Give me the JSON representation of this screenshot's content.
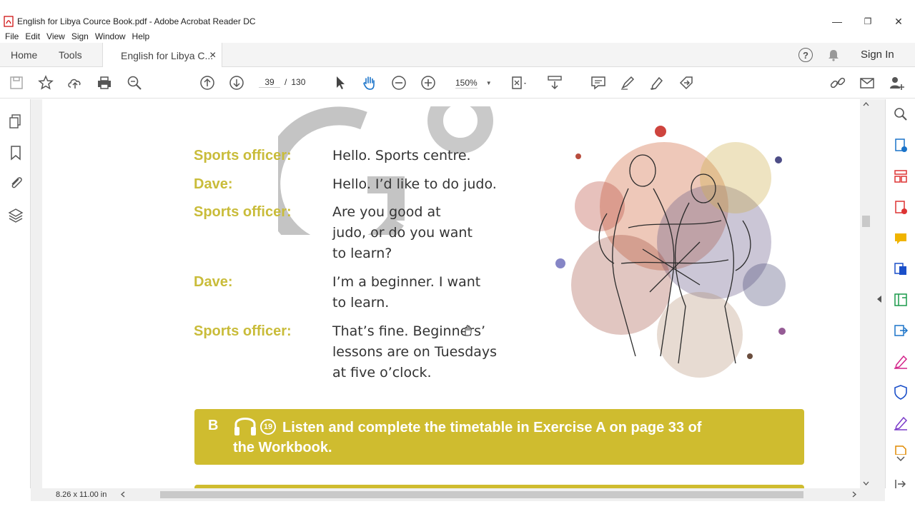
{
  "window": {
    "title": "English for Libya Cource Book.pdf - Adobe Acrobat Reader DC",
    "controls": {
      "minimize": "—",
      "restore": "❐",
      "close": "✕"
    }
  },
  "menu": [
    "File",
    "Edit",
    "View",
    "Sign",
    "Window",
    "Help"
  ],
  "tabs": {
    "home": "Home",
    "tools": "Tools",
    "doc": "English for Libya C...",
    "close": "×"
  },
  "header_right": {
    "help": "?",
    "sign_in": "Sign In"
  },
  "toolbar": {
    "page_current": "39",
    "page_sep": "/",
    "page_total": "130",
    "zoom": "150%"
  },
  "status": {
    "page_size": "8.26 x 11.00 in"
  },
  "document": {
    "dialogue": [
      {
        "speaker": "Sports officer:",
        "text": "Hello. Sports centre."
      },
      {
        "speaker": "Dave:",
        "text": "Hello. I’d like to do judo."
      },
      {
        "speaker": "Sports officer:",
        "lines": [
          "Are you good at",
          "judo, or do you want",
          "to learn?"
        ]
      },
      {
        "speaker": "Dave:",
        "lines": [
          "I’m a beginner. I want",
          "to learn."
        ]
      },
      {
        "speaker": "Sports officer:",
        "lines": [
          "That’s fine. Beginners’",
          "lessons are on Tuesdays",
          "at five o’clock."
        ]
      }
    ],
    "exercise": {
      "letter": "B",
      "track": "19",
      "lines": [
        "Listen and complete the timetable in  Exercise A on page 33 of",
        "the Workbook."
      ]
    }
  },
  "colors": {
    "accent_yellow": "#cfbc2f",
    "speaker_yellow": "#c9bc3a",
    "tab_bg": "#f4f4f4"
  }
}
